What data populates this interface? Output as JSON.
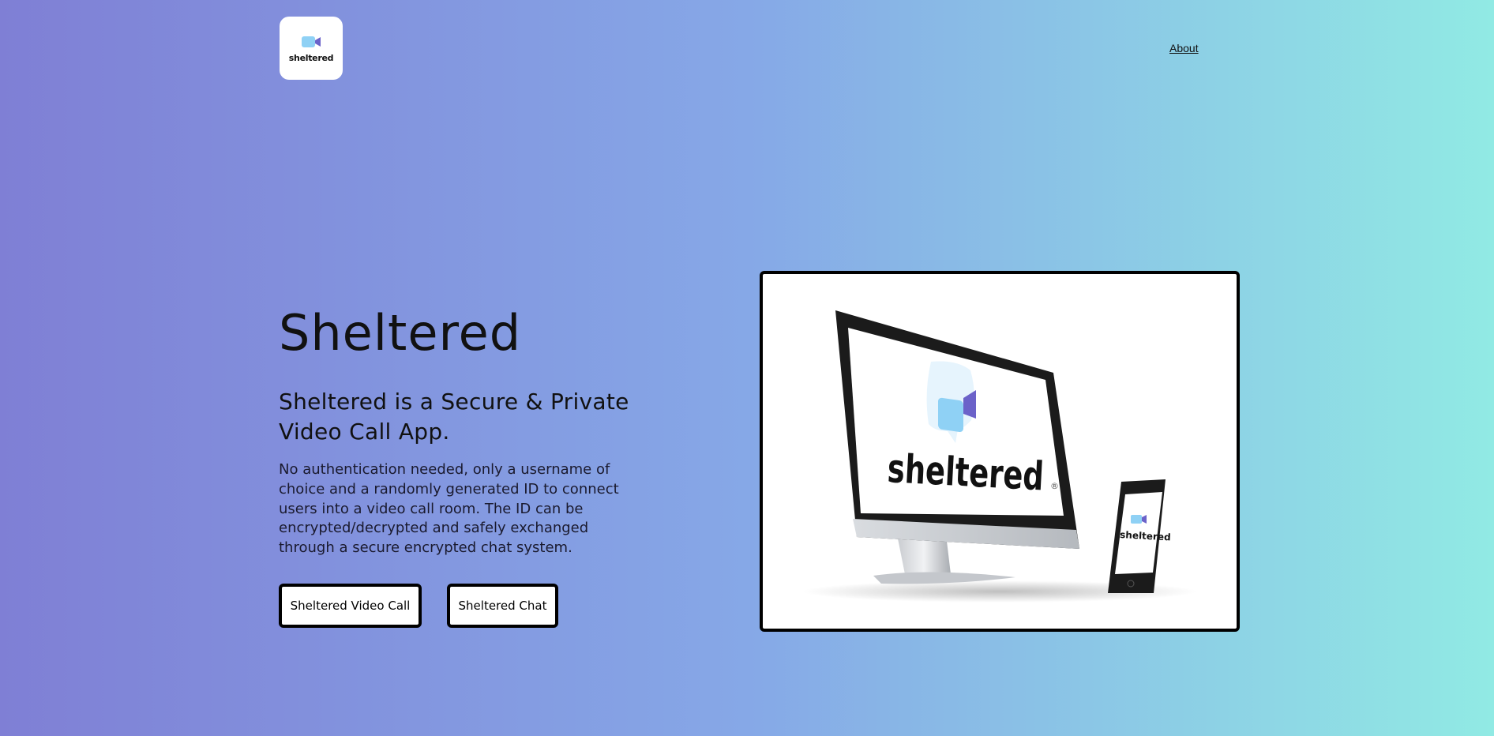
{
  "header": {
    "logo_text": "sheltered",
    "about_label": "About"
  },
  "hero": {
    "title": "Sheltered",
    "subtitle": "Sheltered is a Secure & Private Video Call App.",
    "description": "No authentication needed, only a username of choice and a randomly generated ID to connect users into a video call room. The ID can be encrypted/decrypted and safely exchanged through a secure encrypted chat system.",
    "buttons": {
      "video_call": "Sheltered Video Call",
      "chat": "Sheltered Chat"
    }
  },
  "showcase": {
    "brand_text": "sheltered",
    "registered_mark": "®"
  },
  "colors": {
    "gradient_start": "#7f7fd5",
    "gradient_mid": "#86a8e7",
    "gradient_end": "#91eae4"
  },
  "icons": {
    "logo": "video-camera-icon"
  }
}
